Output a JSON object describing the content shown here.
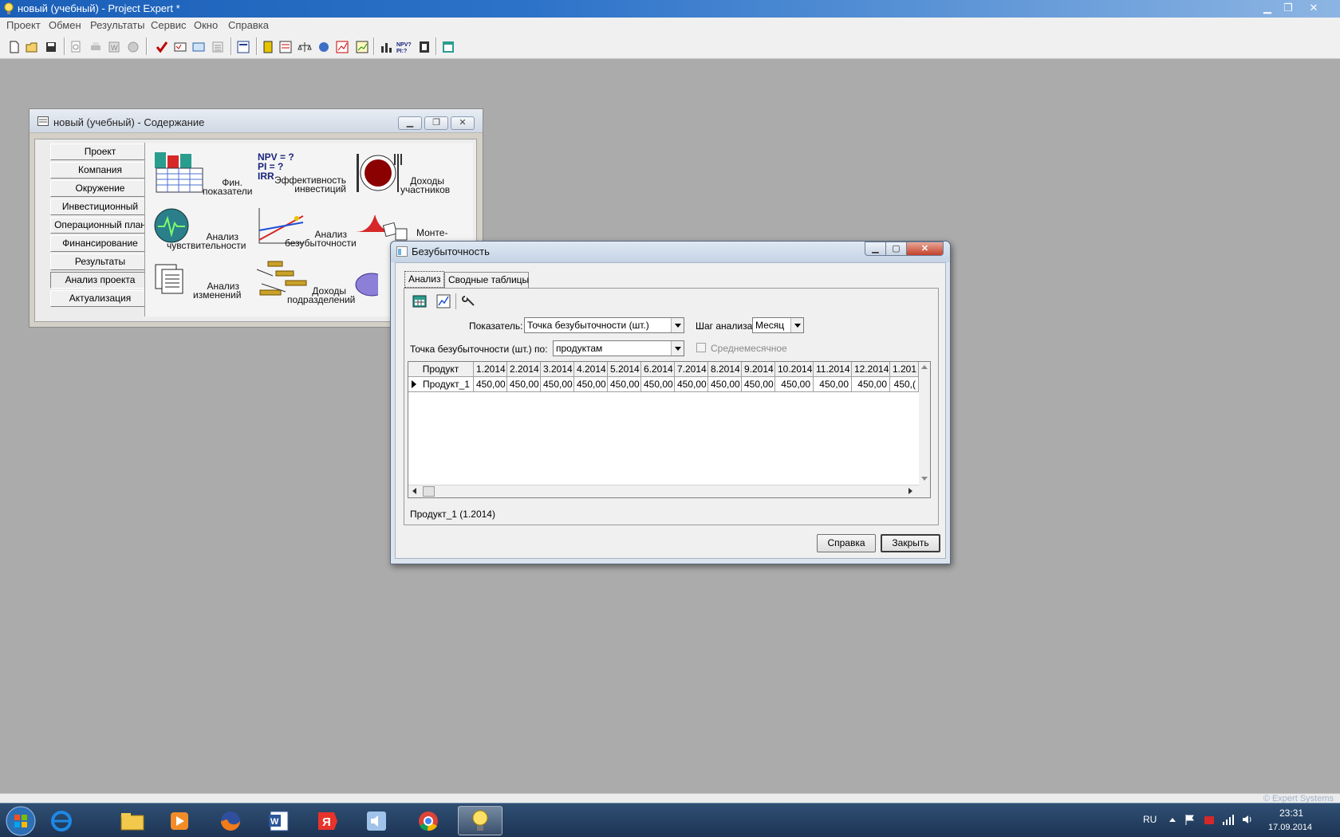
{
  "app": {
    "title": "новый (учебный) - Project Expert *",
    "menu": [
      "Проект",
      "Обмен",
      "Результаты",
      "Сервис",
      "Окно",
      "Справка"
    ]
  },
  "contents_window": {
    "title": "новый (учебный) - Содержание",
    "nav": [
      "Проект",
      "Компания",
      "Окружение",
      "Инвестиционный план",
      "Операционный план",
      "Финансирование",
      "Результаты",
      "Анализ проекта",
      "Актуализация"
    ],
    "items": {
      "fin": [
        "Фин.",
        "показатели"
      ],
      "eff": [
        "Эффективность",
        "инвестиций"
      ],
      "income_part": [
        "Доходы",
        "участников"
      ],
      "sens": [
        "Анализ",
        "чувствительности"
      ],
      "breakeven": [
        "Анализ",
        "безубыточности"
      ],
      "monte": [
        "Монте-"
      ],
      "changes": [
        "Анализ",
        "изменений"
      ],
      "div_income": [
        "Доходы",
        "подразделений"
      ],
      "npv_text": [
        "NPV = ?",
        "PI = ?",
        "IRR"
      ]
    }
  },
  "dialog": {
    "title": "Безубыточность",
    "tabs": [
      "Анализ",
      "Сводные таблицы"
    ],
    "indicator_label": "Показатель:",
    "indicator_value": "Точка безубыточности (шт.)",
    "step_label": "Шаг анализа :",
    "step_value": "Месяц",
    "by_label": "Точка безубыточности (шт.) по:",
    "by_value": "продуктам",
    "monthly_avg_label": "Среднемесячное",
    "table": {
      "columns": [
        "Продукт",
        "1.2014",
        "2.2014",
        "3.2014",
        "4.2014",
        "5.2014",
        "6.2014",
        "7.2014",
        "8.2014",
        "9.2014",
        "10.2014",
        "11.2014",
        "12.2014",
        "1.201"
      ],
      "rows": [
        [
          "Продукт_1",
          "450,00",
          "450,00",
          "450,00",
          "450,00",
          "450,00",
          "450,00",
          "450,00",
          "450,00",
          "450,00",
          "450,00",
          "450,00",
          "450,00",
          "450,("
        ]
      ]
    },
    "status": "Продукт_1 (1.2014)",
    "help_button": "Справка",
    "close_button": "Закрыть"
  },
  "statusbar": {
    "copyright": "© Expert Systems"
  },
  "taskbar": {
    "lang": "RU",
    "time": "23:31",
    "date": "17.09.2014"
  }
}
